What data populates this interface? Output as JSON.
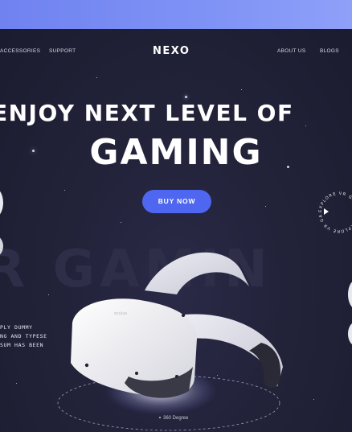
{
  "nav": {
    "left_items": [
      "ACCESSORIES",
      "SUPPORT"
    ],
    "logo": "NEXO",
    "right_items": [
      "ABOUT US",
      "BLOGS"
    ]
  },
  "hero": {
    "headline": "ENJOY NEXT LEVEL OF",
    "title": "GAMING",
    "cta_label": "BUY NOW",
    "background_word": "R GAMIN",
    "description_lines": [
      "PLY DUMMY",
      "NG AND TYPESE",
      "SUM HAS BEEN"
    ],
    "rotation_label": "360 Degree",
    "explore_badge": "EXPLORE VR GAMES"
  },
  "colors": {
    "accent": "#4f66f0",
    "top_band": "#7f93f6",
    "background": "#1d1d33"
  }
}
